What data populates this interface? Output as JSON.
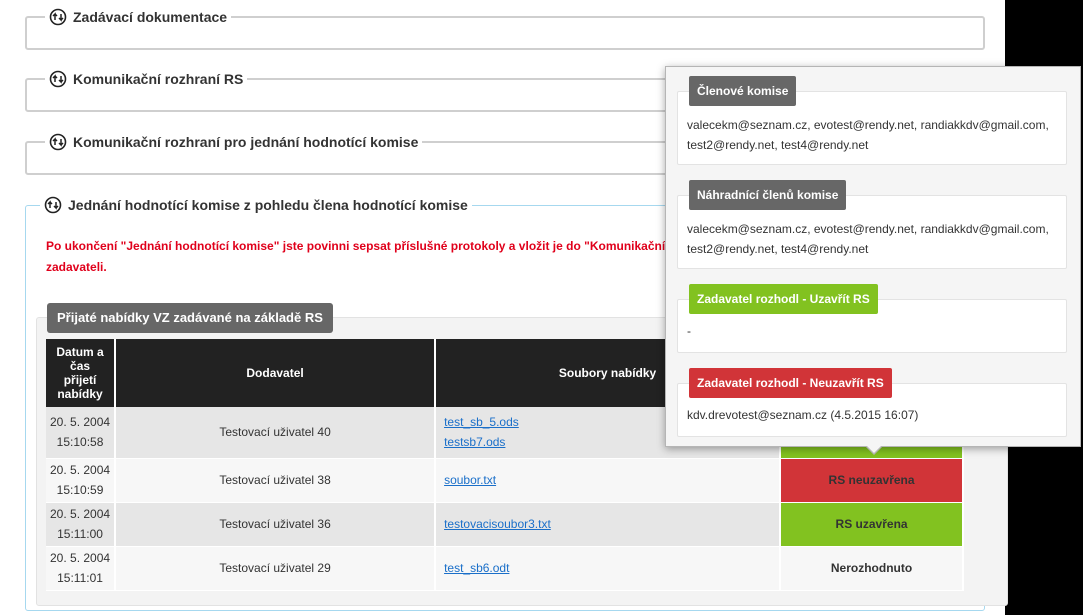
{
  "sections": {
    "doc": "Zadávací dokumentace",
    "rs": "Komunikační rozhraní RS",
    "commission": "Komunikační rozhraní pro jednání hodnotící komise",
    "member_view": "Jednání hodnotící komise z pohledu člena hodnotící komise"
  },
  "warning": {
    "line1": "Po ukončení \"Jednání hodnotící komise\" jste povinni sepsat příslušné protokoly a vložit je do \"Komunikační r",
    "line2": "zadavateli."
  },
  "offers_panel": {
    "title": "Přijaté nabídky VZ zadávané na základě RS",
    "headers": {
      "date": [
        "Datum a",
        "čas",
        "přijetí",
        "nabídky"
      ],
      "supplier": "Dodavatel",
      "files": "Soubory nabídky"
    },
    "rows": [
      {
        "date": "20. 5. 2004",
        "time": "15:10:58",
        "supplier": "Testovací uživatel 40",
        "files": [
          "test_sb_5.ods",
          "testsb7.ods"
        ],
        "status": ""
      },
      {
        "date": "20. 5. 2004",
        "time": "15:10:59",
        "supplier": "Testovací uživatel 38",
        "files": [
          "soubor.txt"
        ],
        "status": "RS neuzavřena"
      },
      {
        "date": "20. 5. 2004",
        "time": "15:11:00",
        "supplier": "Testovací uživatel 36",
        "files": [
          "testovacisoubor3.txt"
        ],
        "status": "RS uzavřena"
      },
      {
        "date": "20. 5. 2004",
        "time": "15:11:01",
        "supplier": "Testovací uživatel 29",
        "files": [
          "test_sb6.odt"
        ],
        "status": "Nerozhodnuto"
      }
    ]
  },
  "popover": {
    "members_title": "Členové komise",
    "members": [
      "valecekm@seznam.cz, evotest@rendy.net, randiakkdv@gmail.com,",
      "test2@rendy.net, test4@rendy.net"
    ],
    "substitutes_title": "Náhradnící členů komise",
    "substitutes": [
      "valecekm@seznam.cz, evotest@rendy.net, randiakkdv@gmail.com,",
      "test2@rendy.net, test4@rendy.net"
    ],
    "close_title": "Zadavatel rozhodl - Uzavřít RS",
    "close_value": "-",
    "notclose_title": "Zadavatel rozhodl - Neuzavřít RS",
    "notclose_value": "kdv.drevotest@seznam.cz (4.5.2015 16:07)"
  },
  "colors": {
    "red": "#d13438",
    "green": "#82c220",
    "header_gray": "#676767",
    "table_header": "#222222",
    "link": "#1a6fc9",
    "warning": "#e0001b"
  },
  "icons": {
    "section_toggle": "cycle-arrows-icon"
  }
}
